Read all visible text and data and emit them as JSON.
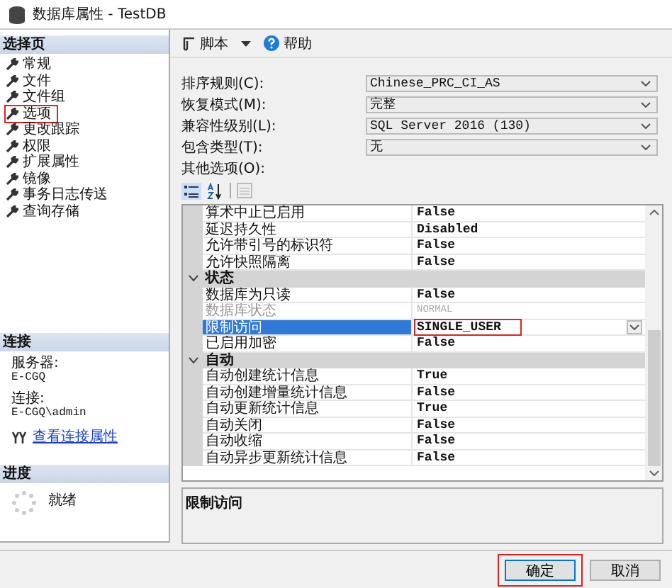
{
  "window": {
    "title": "数据库属性 - TestDB"
  },
  "select_page": {
    "header": "选择页",
    "items": [
      {
        "label": "常规",
        "annotated": false
      },
      {
        "label": "文件",
        "annotated": false
      },
      {
        "label": "文件组",
        "annotated": false
      },
      {
        "label": "选项",
        "annotated": true
      },
      {
        "label": "更改跟踪",
        "annotated": false
      },
      {
        "label": "权限",
        "annotated": false
      },
      {
        "label": "扩展属性",
        "annotated": false
      },
      {
        "label": "镜像",
        "annotated": false
      },
      {
        "label": "事务日志传送",
        "annotated": false
      },
      {
        "label": "查询存储",
        "annotated": false
      }
    ]
  },
  "connection": {
    "header": "连接",
    "server_label": "服务器:",
    "server": "E-CGQ",
    "connection_label": "连接:",
    "connection": "E-CGQ\\admin",
    "link": "查看连接属性"
  },
  "progress": {
    "header": "进度",
    "status": "就绪"
  },
  "toolbar": {
    "script": "脚本",
    "help": "帮助"
  },
  "form": [
    {
      "label": "排序规则(C):",
      "value": "Chinese_PRC_CI_AS"
    },
    {
      "label": "恢复模式(M):",
      "value": "完整"
    },
    {
      "label": "兼容性级别(L):",
      "value": "SQL Server 2016 (130)"
    },
    {
      "label": "包含类型(T):",
      "value": "无"
    }
  ],
  "other_options_label": "其他选项(O):",
  "property_grid": {
    "rows": [
      {
        "kind": "property",
        "name": "算术中止已启用",
        "value": "False",
        "disabled": false,
        "selected": false,
        "annotated": false
      },
      {
        "kind": "property",
        "name": "延迟持久性",
        "value": "Disabled",
        "disabled": false,
        "selected": false,
        "annotated": false
      },
      {
        "kind": "property",
        "name": "允许带引号的标识符",
        "value": "False",
        "disabled": false,
        "selected": false,
        "annotated": false
      },
      {
        "kind": "property",
        "name": "允许快照隔离",
        "value": "False",
        "disabled": false,
        "selected": false,
        "annotated": false
      },
      {
        "kind": "category",
        "name": "状态",
        "expanded": true
      },
      {
        "kind": "property",
        "name": "数据库为只读",
        "value": "False",
        "disabled": false,
        "selected": false,
        "annotated": false
      },
      {
        "kind": "property",
        "name": "数据库状态",
        "value": "NORMAL",
        "disabled": true,
        "selected": false,
        "annotated": false
      },
      {
        "kind": "property",
        "name": "限制访问",
        "value": "SINGLE_USER",
        "disabled": false,
        "selected": true,
        "annotated": true
      },
      {
        "kind": "property",
        "name": "已启用加密",
        "value": "False",
        "disabled": false,
        "selected": false,
        "annotated": false
      },
      {
        "kind": "category",
        "name": "自动",
        "expanded": true
      },
      {
        "kind": "property",
        "name": "自动创建统计信息",
        "value": "True",
        "disabled": false,
        "selected": false,
        "annotated": false
      },
      {
        "kind": "property",
        "name": "自动创建增量统计信息",
        "value": "False",
        "disabled": false,
        "selected": false,
        "annotated": false
      },
      {
        "kind": "property",
        "name": "自动更新统计信息",
        "value": "True",
        "disabled": false,
        "selected": false,
        "annotated": false
      },
      {
        "kind": "property",
        "name": "自动关闭",
        "value": "False",
        "disabled": false,
        "selected": false,
        "annotated": false
      },
      {
        "kind": "property",
        "name": "自动收缩",
        "value": "False",
        "disabled": false,
        "selected": false,
        "annotated": false
      },
      {
        "kind": "property",
        "name": "自动异步更新统计信息",
        "value": "False",
        "disabled": false,
        "selected": false,
        "annotated": false
      }
    ],
    "description": "限制访问"
  },
  "buttons": [
    {
      "label": "确定",
      "focused": true,
      "annotated": true
    },
    {
      "label": "取消",
      "focused": false,
      "annotated": false
    }
  ]
}
